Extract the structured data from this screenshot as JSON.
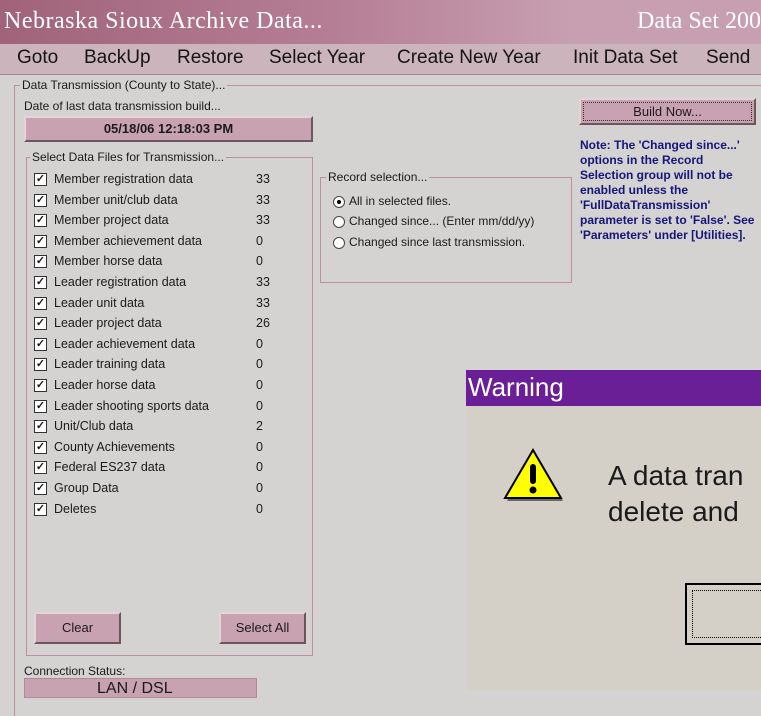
{
  "window": {
    "title": "Nebraska  Sioux   Archive Data...",
    "title_right": "Data Set 200"
  },
  "menu": [
    "Goto",
    "BackUp",
    "Restore",
    "Select Year",
    "Create New Year",
    "Init Data Set",
    "Send"
  ],
  "transmission": {
    "group_label": "Data Transmission (County to State)...",
    "date_label": "Date of last data transmission build...",
    "date_value": "05/18/06 12:18:03 PM",
    "build_button": "Build Now...",
    "note": "Note: The 'Changed since...' options in the Record Selection group will not be enabled unless the 'FullDataTransmission' parameter is set to 'False'.  See 'Parameters' under [Utilities]."
  },
  "files": {
    "group_label": "Select Data Files for Transmission...",
    "items": [
      {
        "label": "Member registration data",
        "count": "33",
        "checked": true
      },
      {
        "label": "Member unit/club data",
        "count": "33",
        "checked": true
      },
      {
        "label": "Member project data",
        "count": "33",
        "checked": true
      },
      {
        "label": "Member achievement data",
        "count": "0",
        "checked": true
      },
      {
        "label": "Member horse data",
        "count": "0",
        "checked": true
      },
      {
        "label": "Leader registration data",
        "count": "33",
        "checked": true
      },
      {
        "label": "Leader unit data",
        "count": "33",
        "checked": true
      },
      {
        "label": "Leader project data",
        "count": "26",
        "checked": true
      },
      {
        "label": "Leader achievement data",
        "count": "0",
        "checked": true
      },
      {
        "label": "Leader training data",
        "count": "0",
        "checked": true
      },
      {
        "label": "Leader horse data",
        "count": "0",
        "checked": true
      },
      {
        "label": "Leader shooting sports data",
        "count": "0",
        "checked": true
      },
      {
        "label": "Unit/Club data",
        "count": "2",
        "checked": true
      },
      {
        "label": "County Achievements",
        "count": "0",
        "checked": true
      },
      {
        "label": "Federal ES237 data",
        "count": "0",
        "checked": true
      },
      {
        "label": "Group Data",
        "count": "0",
        "checked": true
      },
      {
        "label": "Deletes",
        "count": "0",
        "checked": true
      }
    ],
    "clear_button": "Clear",
    "select_all_button": "Select All"
  },
  "record_selection": {
    "group_label": "Record selection...",
    "options": [
      {
        "label": "All in selected files.",
        "selected": true
      },
      {
        "label": "Changed since... (Enter mm/dd/yy)",
        "selected": false
      },
      {
        "label": "Changed since last transmission.",
        "selected": false
      }
    ]
  },
  "connection": {
    "label": "Connection Status:",
    "value": "LAN / DSL"
  },
  "warning": {
    "title": "Warning",
    "line1": "A data tran",
    "line2": "delete and",
    "icon": "warning-triangle-icon"
  },
  "colors": {
    "title_bar": "#a0637a",
    "menu_bar": "#cbb4bc",
    "button_pink": "#c9a2b1",
    "note_text": "#15157a",
    "warning_title": "#6a1f96"
  }
}
